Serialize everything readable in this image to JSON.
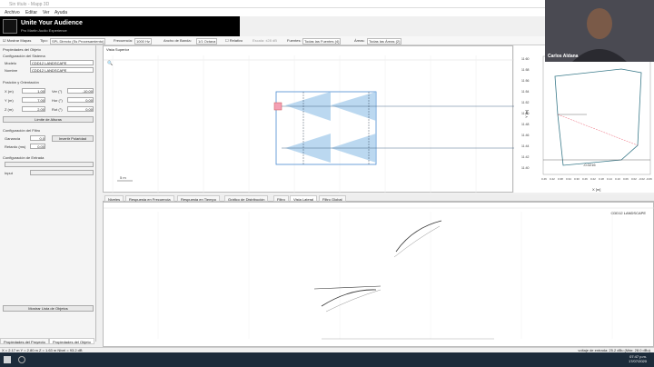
{
  "window": {
    "title": "Sin título - Mapp 3D"
  },
  "menu": [
    "Archivo",
    "Editar",
    "Ver",
    "Ayuda"
  ],
  "banner": {
    "title": "Unite Your Audience",
    "subtitle": "Pro Martin Audio Experience"
  },
  "toolbar": {
    "mostrar_mapas": "Mostrar Mapas",
    "tipo": "Tipo:",
    "tipo_value": "SPL Directo (Ss Procesamiento)",
    "frecuencia": "Frecuencia:",
    "frecuencia_value": "1000 Hz",
    "ancho_banda": "Ancho de Banda:",
    "ancho_banda_value": "1/1 Octava",
    "relativo": "Relativo",
    "escala": "Escala: ±28 dB",
    "fuentes": "Fuentes:",
    "fuentes_value": "Todas las Fuentes (4)",
    "areas": "Áreas:",
    "areas_value": "Todas las Áreas (2)"
  },
  "leftpanel": {
    "propiedades_objeto": "Propiedades del Objeto",
    "config_sistema": "Configuración del Sistema",
    "modelo_label": "Modelo",
    "modelo_value": "CDD12 LANDSCAPE",
    "nombre_label": "Nombre",
    "nombre_value": "CDD12 LANDSCAPE",
    "posicion": "Posición y Orientación",
    "x_label": "X (m)",
    "x_value": "1.00",
    "y_label": "Y (m)",
    "y_value": "7.00",
    "z_label": "Z (m)",
    "z_value": "2.00",
    "ver_label": "Ver (°)",
    "ver_value": "-10.00",
    "hor_label": "Hor (°)",
    "hor_value": "0.00",
    "rot_label": "Rot (°)",
    "rot_value": "0.00",
    "limite_btn": "Límite de Alturas",
    "config_filtro": "Configuración del Filtro",
    "ganancia_label": "Ganancia",
    "ganancia_value": "0.0",
    "retardo_label": "Retardo (ms)",
    "retardo_value": "0.00",
    "invertir_btn": "Invertir Polaridad",
    "config_entrada": "Configuración de Entrada",
    "input_label": "Input",
    "mostrar_lista": "Mostrar Lista de Objetos",
    "tab_proyecto": "Propiedades del Proyecto",
    "tab_objeto": "Propiedades del Objeto"
  },
  "topview": {
    "title": "Vista Superior",
    "scale": "5 m"
  },
  "sideview": {
    "title": "Vista Lateral",
    "speaker": "CDD12 LANDSCAPE",
    "y_ticks": [
      "11:60",
      "11:58",
      "11:56",
      "11:54",
      "11:52",
      "11:50",
      "11:48",
      "11:46",
      "11:44",
      "11:42",
      "11:40"
    ],
    "x_ticks": [
      "0.46",
      "0.42",
      "0.38",
      "0.34",
      "0.30",
      "0.26",
      "0.22",
      "0.18",
      "0.14",
      "0.10",
      "0.06",
      "0.02",
      "-0.02",
      "-0.06"
    ],
    "ylabel": "Y [m]",
    "xlabel": "X [m]",
    "range": "-0.0216"
  },
  "tabs": [
    "Niveles",
    "Respuesta en Frecuencia",
    "Respuesta en Tiempo",
    "Gráfico de Distribución",
    "Filtro",
    "Vista Lateral",
    "Filtro Global"
  ],
  "bottomview": {
    "speaker": "CDD12 LANDSCAPE"
  },
  "status": {
    "left": "X = 2.17 m Y = 2.80 m Z = 1.63 m Nivel = 93.2 dB",
    "right": "voltaje de entrada: 25.2 dBu (Máx: 28.0 dBu)"
  },
  "taskbar": {
    "time": "07:47 p.m.",
    "date": "17/07/2020"
  },
  "webcam": {
    "name": "Carlos Aldana"
  }
}
